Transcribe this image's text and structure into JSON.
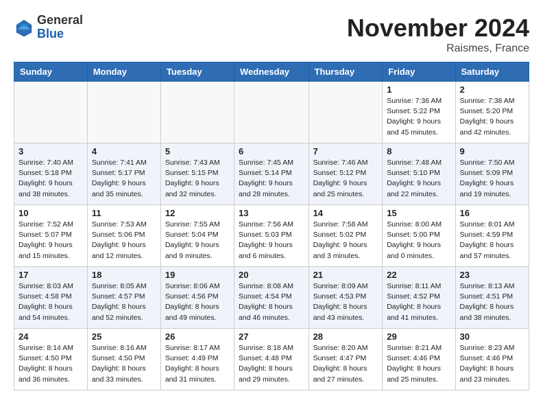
{
  "header": {
    "logo_general": "General",
    "logo_blue": "Blue",
    "title": "November 2024",
    "location": "Raismes, France"
  },
  "weekdays": [
    "Sunday",
    "Monday",
    "Tuesday",
    "Wednesday",
    "Thursday",
    "Friday",
    "Saturday"
  ],
  "weeks": [
    [
      {
        "day": "",
        "info": ""
      },
      {
        "day": "",
        "info": ""
      },
      {
        "day": "",
        "info": ""
      },
      {
        "day": "",
        "info": ""
      },
      {
        "day": "",
        "info": ""
      },
      {
        "day": "1",
        "info": "Sunrise: 7:36 AM\nSunset: 5:22 PM\nDaylight: 9 hours\nand 45 minutes."
      },
      {
        "day": "2",
        "info": "Sunrise: 7:38 AM\nSunset: 5:20 PM\nDaylight: 9 hours\nand 42 minutes."
      }
    ],
    [
      {
        "day": "3",
        "info": "Sunrise: 7:40 AM\nSunset: 5:18 PM\nDaylight: 9 hours\nand 38 minutes."
      },
      {
        "day": "4",
        "info": "Sunrise: 7:41 AM\nSunset: 5:17 PM\nDaylight: 9 hours\nand 35 minutes."
      },
      {
        "day": "5",
        "info": "Sunrise: 7:43 AM\nSunset: 5:15 PM\nDaylight: 9 hours\nand 32 minutes."
      },
      {
        "day": "6",
        "info": "Sunrise: 7:45 AM\nSunset: 5:14 PM\nDaylight: 9 hours\nand 28 minutes."
      },
      {
        "day": "7",
        "info": "Sunrise: 7:46 AM\nSunset: 5:12 PM\nDaylight: 9 hours\nand 25 minutes."
      },
      {
        "day": "8",
        "info": "Sunrise: 7:48 AM\nSunset: 5:10 PM\nDaylight: 9 hours\nand 22 minutes."
      },
      {
        "day": "9",
        "info": "Sunrise: 7:50 AM\nSunset: 5:09 PM\nDaylight: 9 hours\nand 19 minutes."
      }
    ],
    [
      {
        "day": "10",
        "info": "Sunrise: 7:52 AM\nSunset: 5:07 PM\nDaylight: 9 hours\nand 15 minutes."
      },
      {
        "day": "11",
        "info": "Sunrise: 7:53 AM\nSunset: 5:06 PM\nDaylight: 9 hours\nand 12 minutes."
      },
      {
        "day": "12",
        "info": "Sunrise: 7:55 AM\nSunset: 5:04 PM\nDaylight: 9 hours\nand 9 minutes."
      },
      {
        "day": "13",
        "info": "Sunrise: 7:56 AM\nSunset: 5:03 PM\nDaylight: 9 hours\nand 6 minutes."
      },
      {
        "day": "14",
        "info": "Sunrise: 7:58 AM\nSunset: 5:02 PM\nDaylight: 9 hours\nand 3 minutes."
      },
      {
        "day": "15",
        "info": "Sunrise: 8:00 AM\nSunset: 5:00 PM\nDaylight: 9 hours\nand 0 minutes."
      },
      {
        "day": "16",
        "info": "Sunrise: 8:01 AM\nSunset: 4:59 PM\nDaylight: 8 hours\nand 57 minutes."
      }
    ],
    [
      {
        "day": "17",
        "info": "Sunrise: 8:03 AM\nSunset: 4:58 PM\nDaylight: 8 hours\nand 54 minutes."
      },
      {
        "day": "18",
        "info": "Sunrise: 8:05 AM\nSunset: 4:57 PM\nDaylight: 8 hours\nand 52 minutes."
      },
      {
        "day": "19",
        "info": "Sunrise: 8:06 AM\nSunset: 4:56 PM\nDaylight: 8 hours\nand 49 minutes."
      },
      {
        "day": "20",
        "info": "Sunrise: 8:08 AM\nSunset: 4:54 PM\nDaylight: 8 hours\nand 46 minutes."
      },
      {
        "day": "21",
        "info": "Sunrise: 8:09 AM\nSunset: 4:53 PM\nDaylight: 8 hours\nand 43 minutes."
      },
      {
        "day": "22",
        "info": "Sunrise: 8:11 AM\nSunset: 4:52 PM\nDaylight: 8 hours\nand 41 minutes."
      },
      {
        "day": "23",
        "info": "Sunrise: 8:13 AM\nSunset: 4:51 PM\nDaylight: 8 hours\nand 38 minutes."
      }
    ],
    [
      {
        "day": "24",
        "info": "Sunrise: 8:14 AM\nSunset: 4:50 PM\nDaylight: 8 hours\nand 36 minutes."
      },
      {
        "day": "25",
        "info": "Sunrise: 8:16 AM\nSunset: 4:50 PM\nDaylight: 8 hours\nand 33 minutes."
      },
      {
        "day": "26",
        "info": "Sunrise: 8:17 AM\nSunset: 4:49 PM\nDaylight: 8 hours\nand 31 minutes."
      },
      {
        "day": "27",
        "info": "Sunrise: 8:18 AM\nSunset: 4:48 PM\nDaylight: 8 hours\nand 29 minutes."
      },
      {
        "day": "28",
        "info": "Sunrise: 8:20 AM\nSunset: 4:47 PM\nDaylight: 8 hours\nand 27 minutes."
      },
      {
        "day": "29",
        "info": "Sunrise: 8:21 AM\nSunset: 4:46 PM\nDaylight: 8 hours\nand 25 minutes."
      },
      {
        "day": "30",
        "info": "Sunrise: 8:23 AM\nSunset: 4:46 PM\nDaylight: 8 hours\nand 23 minutes."
      }
    ]
  ]
}
